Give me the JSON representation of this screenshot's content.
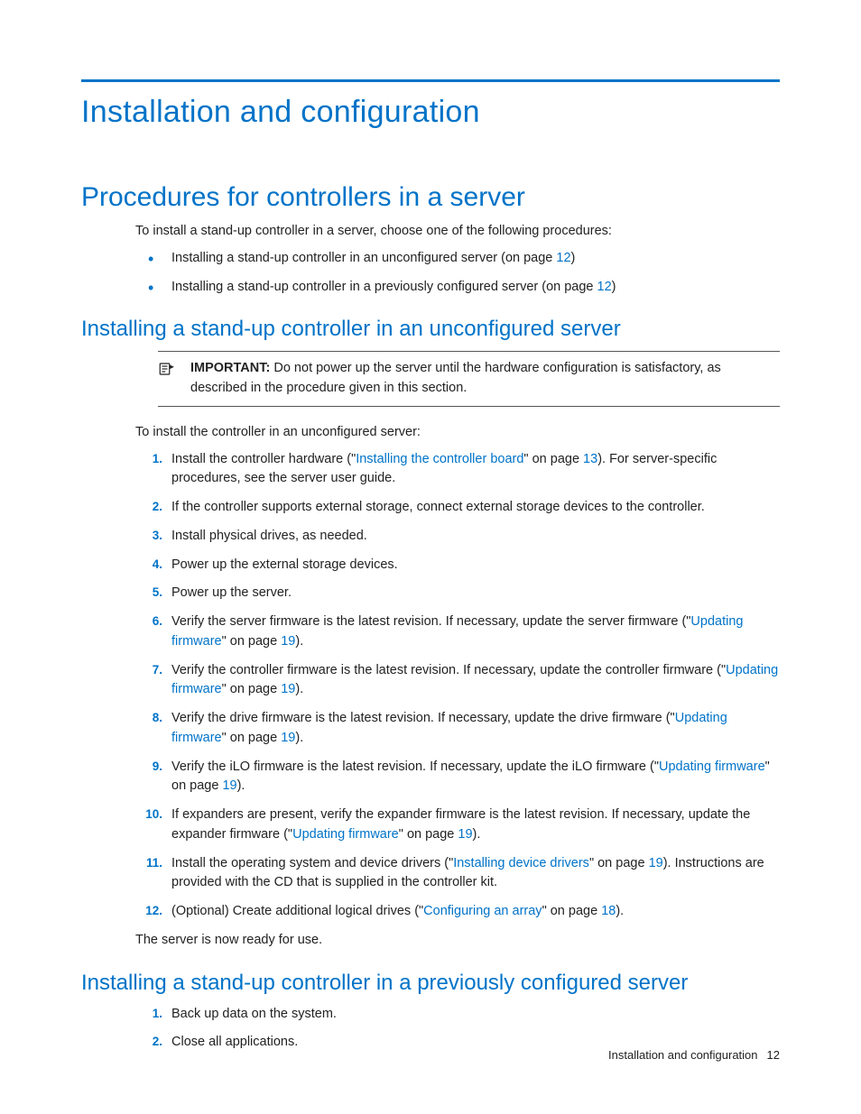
{
  "h1": "Installation and configuration",
  "h2": "Procedures for controllers in a server",
  "intro": "To install a stand-up controller in a server, choose one of the following procedures:",
  "bullets": {
    "b1_pre": "Installing a stand-up controller in an unconfigured server (on page ",
    "b1_page": "12",
    "b1_post": ")",
    "b2_pre": "Installing a stand-up controller in a previously configured server (on page ",
    "b2_page": "12",
    "b2_post": ")"
  },
  "h3a": "Installing a stand-up controller in an unconfigured server",
  "important": {
    "label": "IMPORTANT:",
    "text": "   Do not power up the server until the hardware configuration is satisfactory, as described in the procedure given in this section."
  },
  "intro2": "To install the controller in an unconfigured server:",
  "steps": {
    "s1_a": "Install the controller hardware (\"",
    "s1_link": "Installing the controller board",
    "s1_b": "\" on page ",
    "s1_page": "13",
    "s1_c": "). For server-specific procedures, see the server user guide.",
    "s2": "If the controller supports external storage, connect external storage devices to the controller.",
    "s3": "Install physical drives, as needed.",
    "s4": "Power up the external storage devices.",
    "s5": "Power up the server.",
    "s6_a": "Verify the server firmware is the latest revision. If necessary, update the server firmware (\"",
    "s6_link": "Updating firmware",
    "s6_b": "\" on page ",
    "s6_page": "19",
    "s6_c": ").",
    "s7_a": "Verify the controller firmware is the latest revision. If necessary, update the controller firmware (\"",
    "s7_link": "Updating firmware",
    "s7_b": "\" on page ",
    "s7_page": "19",
    "s7_c": ").",
    "s8_a": "Verify the drive firmware is the latest revision. If necessary, update the drive firmware (\"",
    "s8_link": "Updating firmware",
    "s8_b": "\" on page ",
    "s8_page": "19",
    "s8_c": ").",
    "s9_a": "Verify the iLO firmware is the latest revision. If necessary, update the iLO firmware (\"",
    "s9_link": "Updating firmware",
    "s9_b": "\" on page ",
    "s9_page": "19",
    "s9_c": ").",
    "s10_a": "If expanders are present, verify the expander firmware is the latest revision. If necessary, update the expander firmware (\"",
    "s10_link": "Updating firmware",
    "s10_b": "\" on page ",
    "s10_page": "19",
    "s10_c": ").",
    "s11_a": "Install the operating system and device drivers (\"",
    "s11_link": "Installing device drivers",
    "s11_b": "\" on page ",
    "s11_page": "19",
    "s11_c": "). Instructions are provided with the CD that is supplied in the controller kit.",
    "s12_a": "(Optional) Create additional logical drives (\"",
    "s12_link": "Configuring an array",
    "s12_b": "\" on page ",
    "s12_page": "18",
    "s12_c": ")."
  },
  "outro": "The server is now ready for use.",
  "h3b": "Installing a stand-up controller in a previously configured server",
  "steps2": {
    "s1": "Back up data on the system.",
    "s2": "Close all applications."
  },
  "footer": {
    "text": "Installation and configuration",
    "page": "12"
  }
}
